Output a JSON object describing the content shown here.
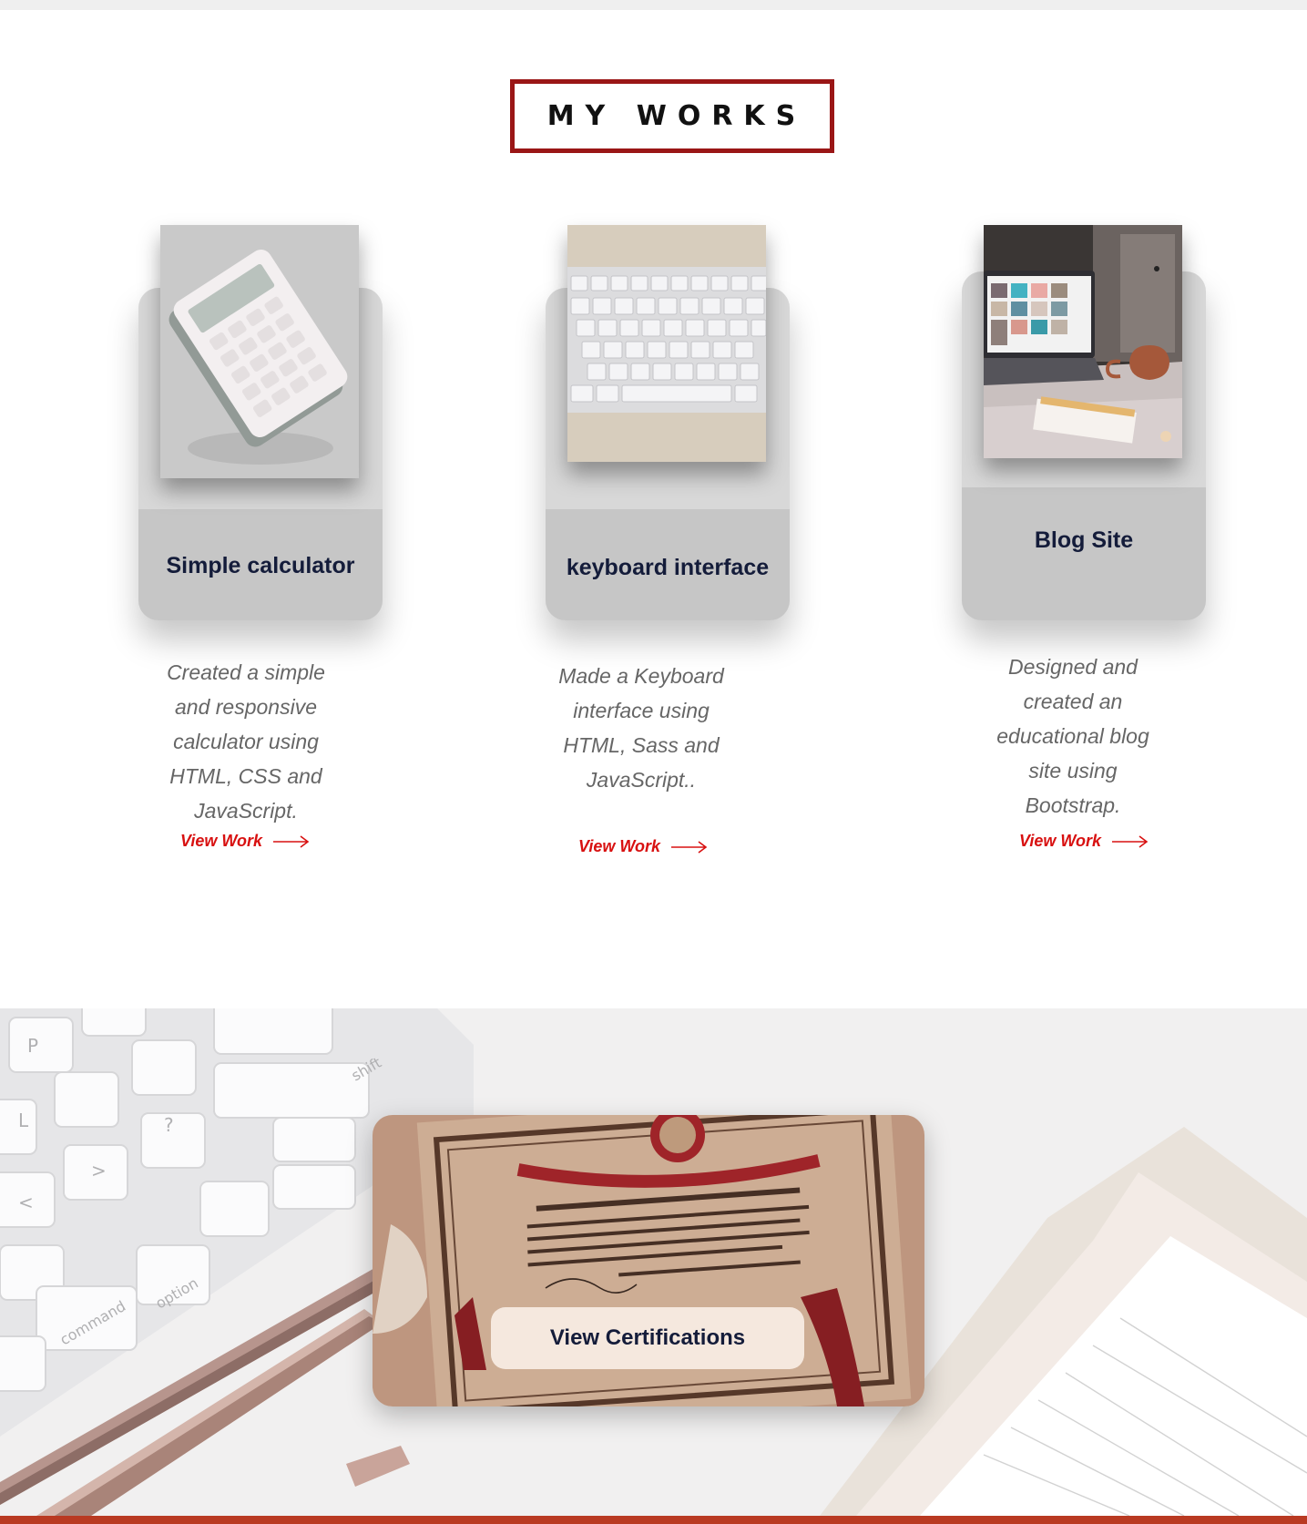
{
  "section": {
    "title": "MY WORKS"
  },
  "works": [
    {
      "title": "Simple calculator",
      "description": [
        "Created a simple",
        "and responsive",
        "calculator using",
        "HTML, CSS and",
        "JavaScript."
      ],
      "link_label": "View Work",
      "image_icon": "calculator-photo"
    },
    {
      "title": "keyboard interface",
      "description": [
        "Made a Keyboard",
        "interface using",
        "HTML, Sass and",
        "JavaScript.."
      ],
      "link_label": "View Work",
      "image_icon": "keyboard-photo"
    },
    {
      "title": "Blog Site",
      "description": [
        "Designed and",
        "created an",
        "educational blog",
        "site using",
        "Bootstrap."
      ],
      "link_label": "View Work",
      "image_icon": "laptop-photo"
    }
  ],
  "certifications": {
    "button_label": "View Certifications"
  },
  "colors": {
    "accent": "#d81010",
    "title_border": "#9a1616",
    "heading_text": "#141c3a"
  }
}
